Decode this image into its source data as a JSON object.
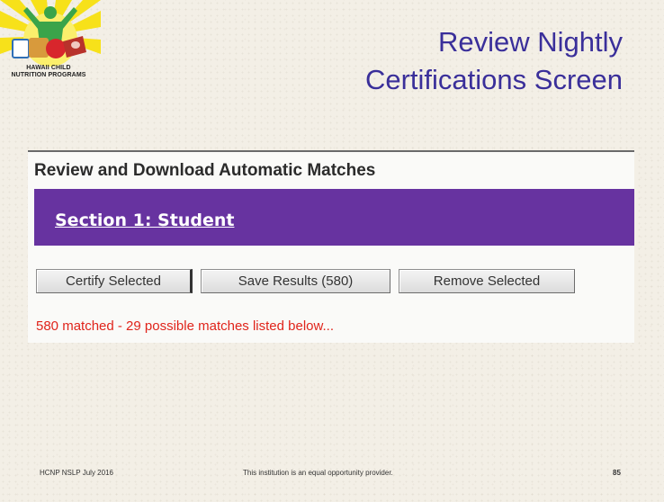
{
  "logo": {
    "line1": "HAWAII CHILD",
    "line2": "NUTRITION PROGRAMS",
    "colors": {
      "sun": "#f7e11a",
      "figure": "#3aa44a",
      "apple": "#d8262c",
      "bread": "#d89a3c",
      "milk": "#ffffff"
    }
  },
  "slide": {
    "title_line1": "Review Nightly",
    "title_line2": "Certifications Screen"
  },
  "panel": {
    "heading": "Review and Download Automatic Matches",
    "section_link": "Section 1:  Student",
    "buttons": {
      "certify": "Certify Selected",
      "save": "Save Results (580)",
      "remove": "Remove Selected"
    },
    "status": "580 matched - 29 possible matches listed below..."
  },
  "footer": {
    "left": "HCNP NSLP July 2016",
    "center": "This institution is an equal opportunity provider.",
    "page_number": "85"
  },
  "colors": {
    "title": "#3a2f9a",
    "section_bar": "#6733a0",
    "status_text": "#e0241b"
  }
}
